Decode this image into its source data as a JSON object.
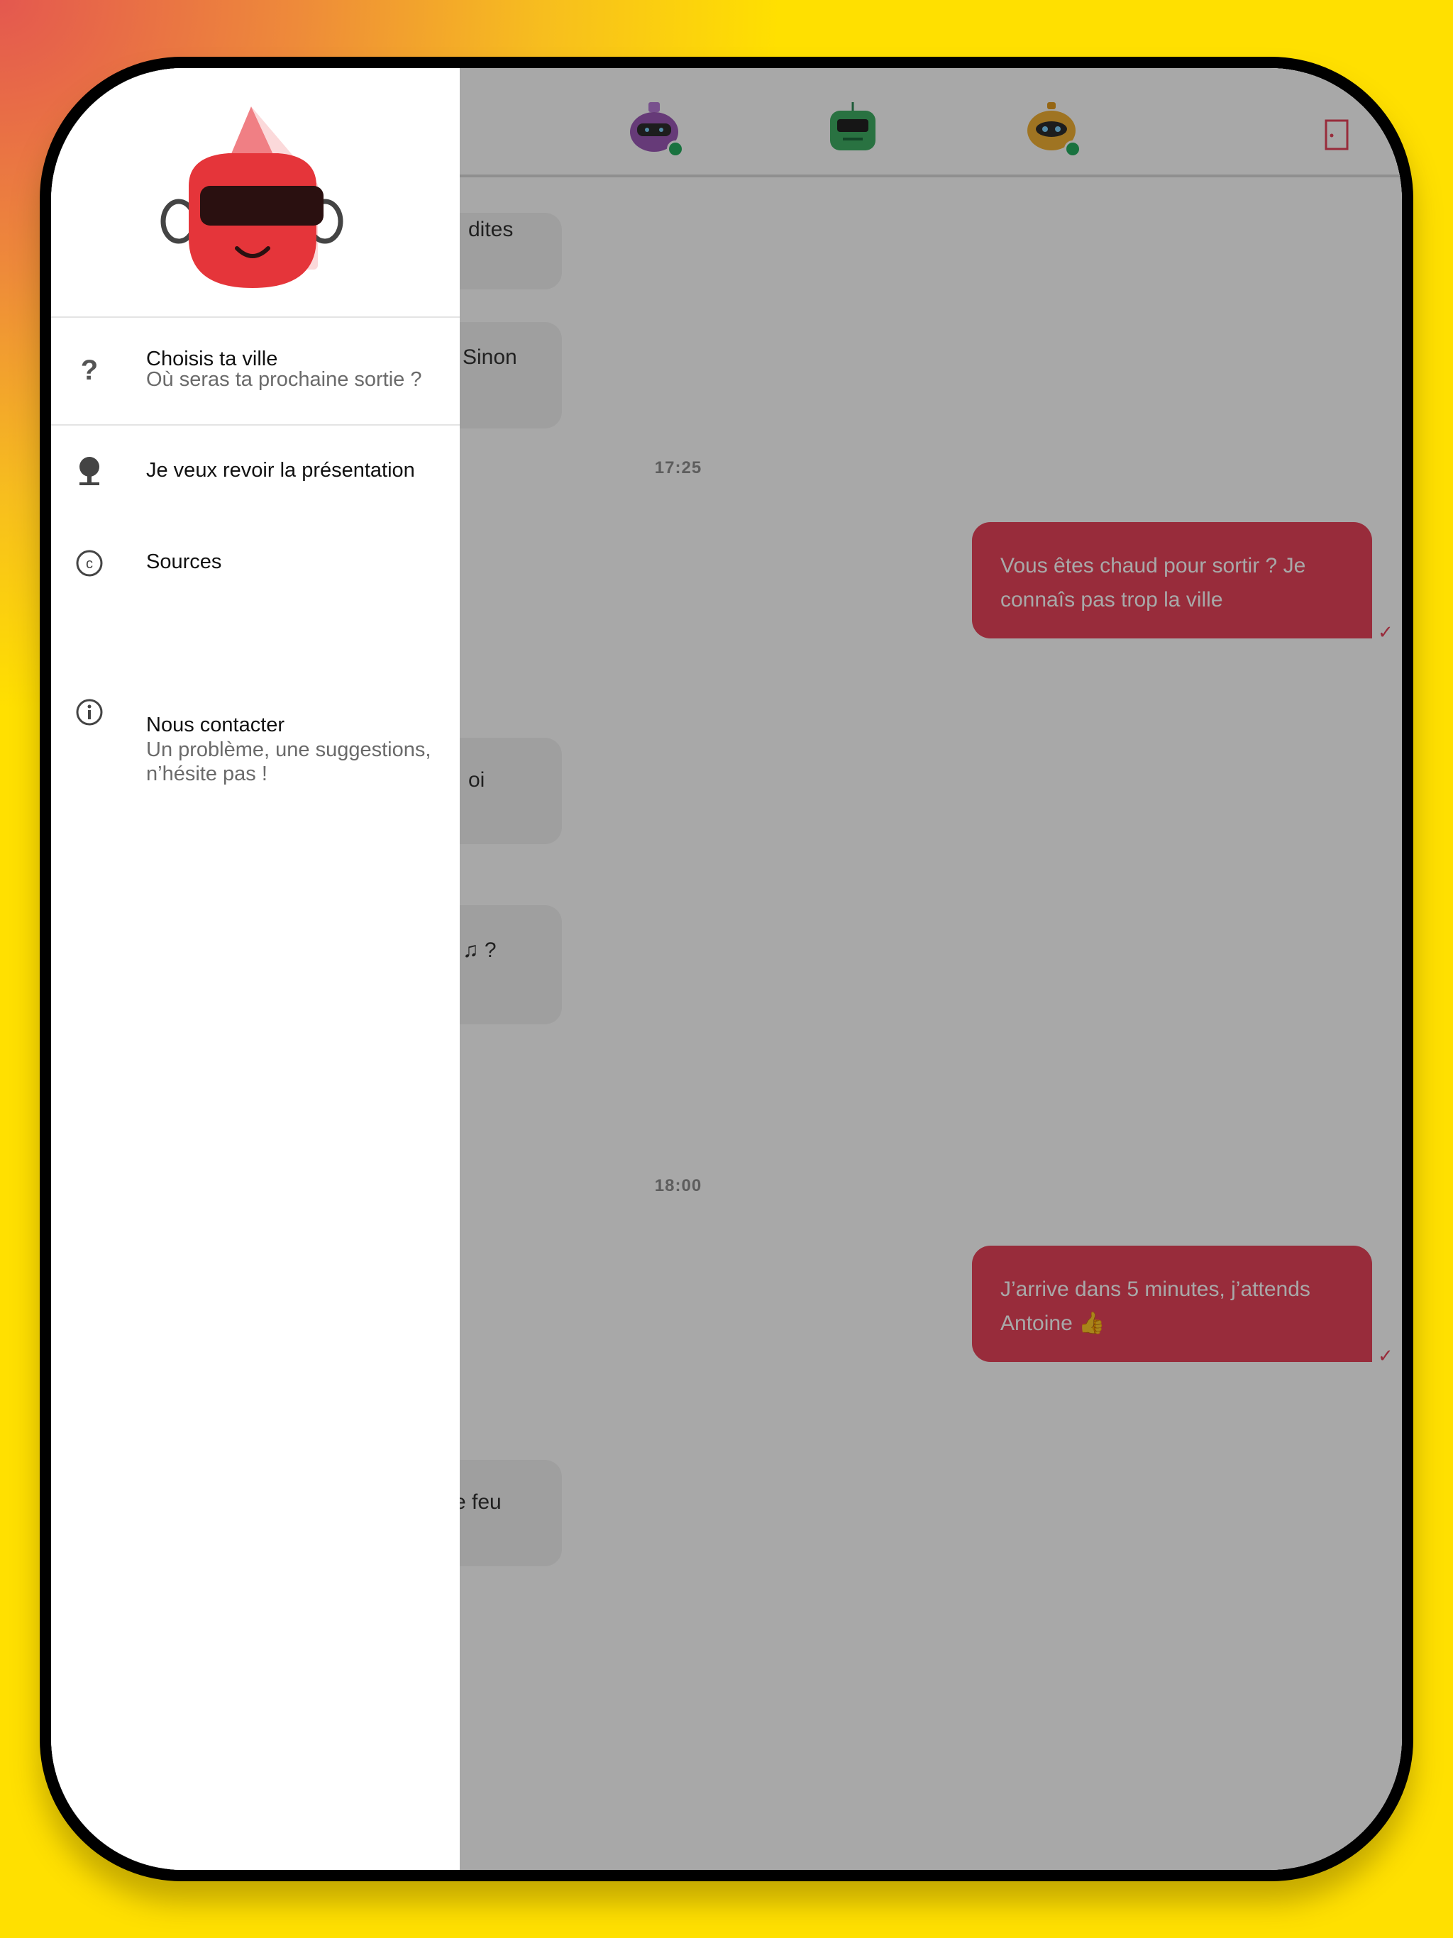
{
  "colors": {
    "background": "#FFE000",
    "accent": "#E7435A",
    "online": "#27ae60",
    "overlay": "rgba(0,0,0,0.34)"
  },
  "topbar": {
    "bots": [
      {
        "name": "purple-bot",
        "color": "#8E44AD",
        "online": true
      },
      {
        "name": "green-bot",
        "color": "#27AE60",
        "online": false
      },
      {
        "name": "yellow-bot",
        "color": "#F2B134",
        "online": true
      }
    ],
    "exit_icon": "door-icon"
  },
  "chat": {
    "incoming_fragments": [
      "dites",
      "Sinon",
      "oi",
      "♫ ?",
      "e feu"
    ],
    "times": [
      "17:25",
      "18:00"
    ],
    "outgoing": [
      {
        "line1": "Vous êtes chaud pour sortir ? Je",
        "line2": "connaîs pas trop la ville"
      },
      {
        "line1": "J’arrive dans 5 minutes, j’attends",
        "line2": "Antoine 👍"
      }
    ]
  },
  "drawer": {
    "header_icon": "red-robot-logo",
    "items": [
      {
        "icon": "question-mark-icon",
        "title": "Choisis ta ville",
        "subtitle": "Où seras ta prochaine sortie ?"
      },
      {
        "icon": "lightbulb-icon",
        "title": "Je veux revoir la présentation"
      },
      {
        "icon": "copyright-icon",
        "title": "Sources"
      },
      {
        "icon": "info-icon",
        "title": "Nous contacter",
        "subtitle": "Un problème, une suggestions, n’hésite pas !"
      }
    ]
  }
}
